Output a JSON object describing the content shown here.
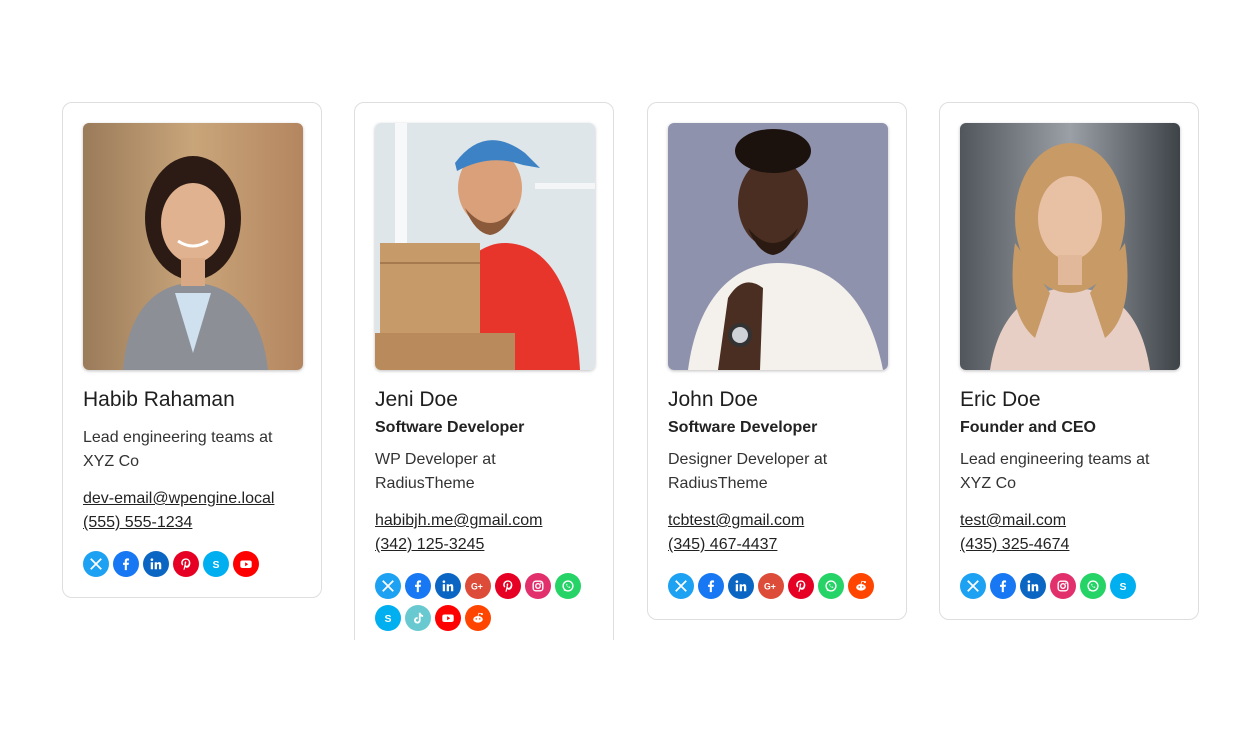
{
  "cards": [
    {
      "name": "Habib Rahaman",
      "role": "",
      "bio": "Lead engineering teams at XYZ Co",
      "email": "dev-email@wpengine.local",
      "phone": "(555) 555-1234",
      "socials": [
        "x-icon",
        "facebook-icon",
        "linkedin-icon",
        "pinterest-icon",
        "skype-icon",
        "youtube-icon"
      ]
    },
    {
      "name": "Jeni Doe",
      "role": "Software Developer",
      "bio": "WP Developer at RadiusTheme",
      "email": "habibjh.me@gmail.com",
      "phone": "(342) 125-3245",
      "socials": [
        "x-icon",
        "facebook-icon",
        "linkedin-icon",
        "google-plus-icon",
        "pinterest-icon",
        "instagram-icon",
        "whatsapp-icon",
        "skype-icon",
        "tiktok-icon",
        "youtube-icon",
        "reddit-icon"
      ]
    },
    {
      "name": "John Doe",
      "role": "Software Developer",
      "bio": "Designer Developer at RadiusTheme",
      "email": "tcbtest@gmail.com",
      "phone": "(345) 467-4437",
      "socials": [
        "x-icon",
        "facebook-icon",
        "linkedin-icon",
        "google-plus-icon",
        "pinterest-icon",
        "whatsapp-icon",
        "reddit-icon"
      ]
    },
    {
      "name": "Eric Doe",
      "role": "Founder and CEO",
      "bio": "Lead engineering teams at XYZ Co",
      "email": "test@mail.com",
      "phone": "(435) 325-4674",
      "socials": [
        "x-icon",
        "facebook-icon",
        "linkedin-icon",
        "instagram-icon",
        "whatsapp-icon",
        "skype-icon"
      ]
    }
  ],
  "social_colors": {
    "x-icon": "#1da1f2",
    "facebook-icon": "#1877f2",
    "linkedin-icon": "#0a66c2",
    "google-plus-icon": "#dd4b39",
    "pinterest-icon": "#e60023",
    "instagram-icon": "#e1306c",
    "whatsapp-icon": "#25d366",
    "skype-icon": "#00aff0",
    "tiktok-icon": "#69c9d0",
    "youtube-icon": "#ff0000",
    "reddit-icon": "#ff4500"
  }
}
